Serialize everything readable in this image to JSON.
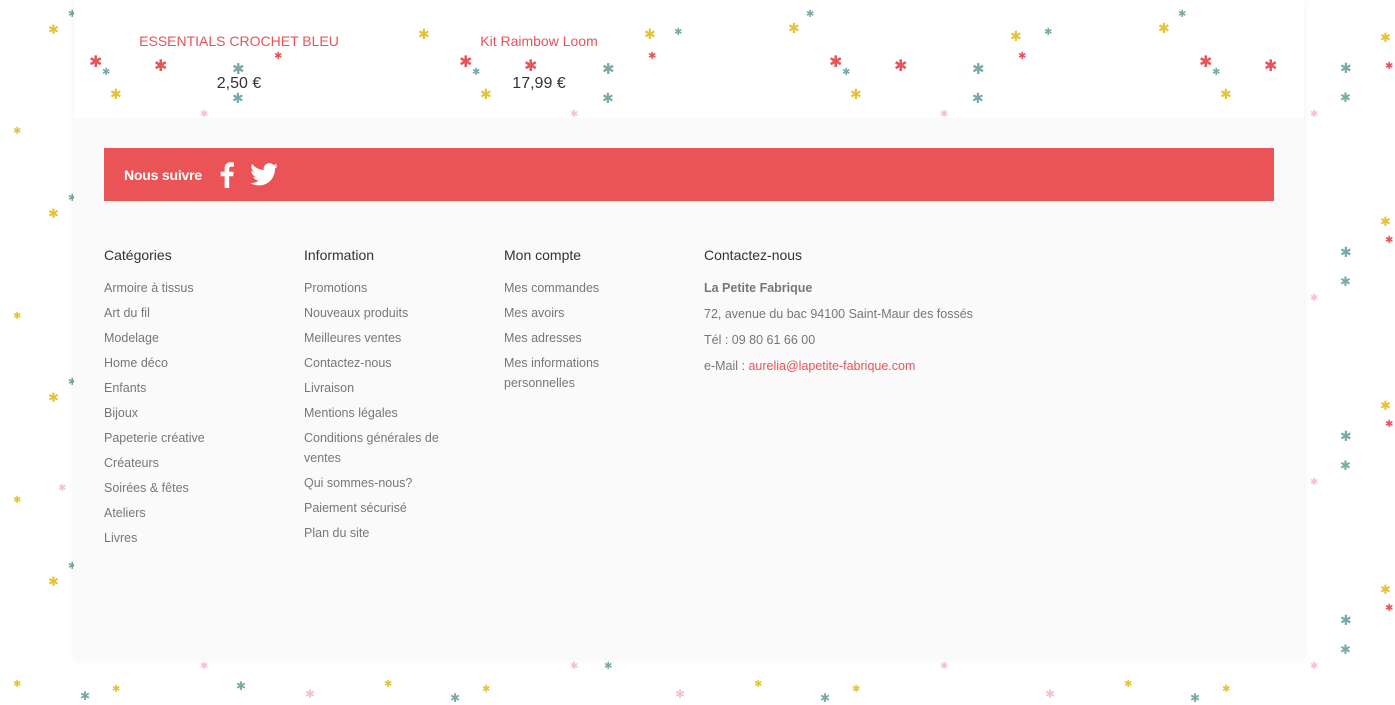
{
  "colors": {
    "accent": "#ea5457",
    "link": "#e8535a",
    "text_muted": "#777777",
    "heading": "#333333",
    "star_red": "#e8535a",
    "star_yellow": "#e3c33b",
    "star_teal": "#7aa9a8",
    "star_pink": "#f2c4cc"
  },
  "products": [
    {
      "name": "ESSENTIALS CROCHET BLEU",
      "price": "2,50 €"
    },
    {
      "name": "Kit Raimbow Loom",
      "price": "17,99 €"
    }
  ],
  "follow": {
    "label": "Nous suivre",
    "icons": [
      "facebook-icon",
      "twitter-icon"
    ]
  },
  "footer": {
    "categories": {
      "title": "Catégories",
      "items": [
        "Armoire à tissus",
        "Art du fil",
        "Modelage",
        "Home déco",
        "Enfants",
        "Bijoux",
        "Papeterie créative",
        "Créateurs",
        "Soirées & fêtes",
        "Ateliers",
        "Livres"
      ]
    },
    "information": {
      "title": "Information",
      "items": [
        "Promotions",
        "Nouveaux produits",
        "Meilleures ventes",
        "Contactez-nous",
        "Livraison",
        "Mentions légales",
        "Conditions générales de ventes",
        "Qui sommes-nous?",
        "Paiement sécurisé",
        "Plan du site"
      ]
    },
    "account": {
      "title": "Mon compte",
      "items": [
        "Mes commandes",
        "Mes avoirs",
        "Mes adresses",
        "Mes informations personnelles"
      ]
    },
    "contact": {
      "title": "Contactez-nous",
      "company": "La Petite Fabrique",
      "address": "72, avenue du bac 94100 Saint-Maur des fossés",
      "phone": "Tél : 09 80 61 66 00",
      "email_label": "e-Mail : ",
      "email": "aurelia@lapetite-fabrique.com"
    }
  }
}
